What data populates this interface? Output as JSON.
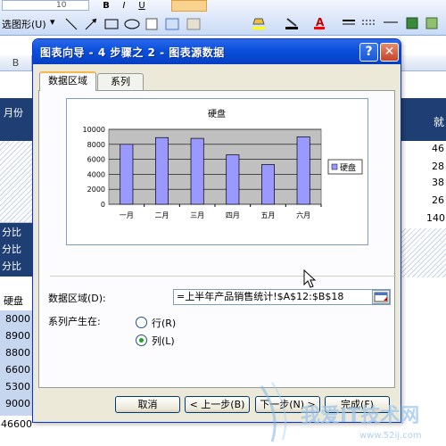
{
  "toolbar": {
    "font_size_value": "10",
    "draw_label": "选图形(U)",
    "draw_menu_arrow": "▾",
    "format_buttons": [
      "B",
      "I",
      "U"
    ]
  },
  "sheet": {
    "column_header": "B",
    "left_cells": [
      "月份",
      "分比",
      "分比",
      "分比",
      "硬盘",
      "8000",
      "8900",
      "8800",
      "6600",
      "5300",
      "9000",
      "46600"
    ],
    "right_cells": [
      "46",
      "28",
      "38",
      "26",
      "140"
    ],
    "right_header_glyph": "就"
  },
  "dialog": {
    "title": "图表向导 - 4 步骤之 2 - 图表源数据",
    "help_symbol": "?",
    "close_symbol": "✕",
    "tabs": [
      {
        "label": "数据区域",
        "active": true
      },
      {
        "label": "系列",
        "active": false
      }
    ],
    "data_range_label": "数据区域(D):",
    "data_range_value": "=上半年产品销售统计!$A$12:$B$18",
    "series_in_label": "系列产生在:",
    "radio_row_label": "行(R)",
    "radio_col_label": "列(L)",
    "series_in_selected": "列",
    "buttons": {
      "cancel": "取消",
      "back": "< 上一步(B)",
      "next": "下一步(N) >",
      "finish": "完成(F)"
    }
  },
  "chart_data": {
    "type": "bar",
    "title": "硬盘",
    "categories": [
      "一月",
      "二月",
      "三月",
      "四月",
      "五月",
      "六月"
    ],
    "series": [
      {
        "name": "硬盘",
        "values": [
          8000,
          8900,
          8800,
          6600,
          5300,
          9000
        ]
      }
    ],
    "ylim": [
      0,
      10000
    ],
    "yticks": [
      "0",
      "2000",
      "4000",
      "6000",
      "8000",
      "10000"
    ],
    "legend": "right",
    "grid": true,
    "colors": {
      "bar": "#9999ff",
      "plot_bg": "#c0c0c0"
    }
  },
  "watermark": {
    "text": "我爱IT技术网",
    "url": "www.52ij.com"
  }
}
